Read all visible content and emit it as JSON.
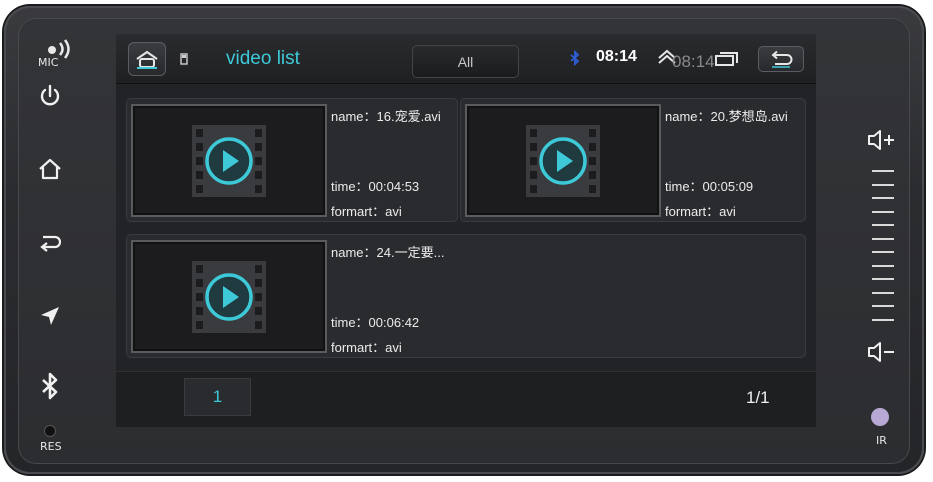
{
  "device": {
    "mic_label": "MIC",
    "res_label": "RES",
    "ir_label": "IR",
    "left_buttons": [
      "power-icon",
      "home-icon",
      "back-arrow-icon",
      "navigation-icon",
      "bluetooth-icon"
    ],
    "right_controls": [
      "volume-up-icon",
      "volume-down-icon"
    ]
  },
  "status_bar": {
    "title": "video list",
    "filter_label": "All",
    "time": "08:14",
    "time_ghost": "08:14",
    "accent_color": "#3ec9d8"
  },
  "videos": [
    {
      "name": "name：16.宠爱.avi",
      "time": "time：00:04:53",
      "format": "formart：avi"
    },
    {
      "name": "name：20.梦想岛.avi",
      "time": "time：00:05:09",
      "format": "formart：avi"
    },
    {
      "name": "name：24.一定要...",
      "time": "time：00:06:42",
      "format": "formart：avi"
    }
  ],
  "footer": {
    "current_page": "1",
    "page_count": "1/1"
  }
}
